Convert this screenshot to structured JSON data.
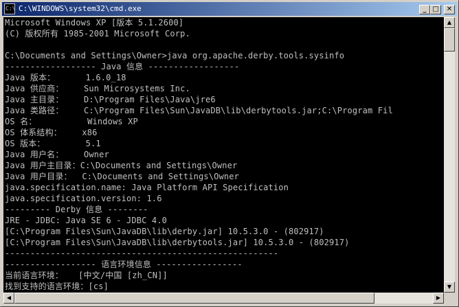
{
  "window": {
    "title": "C:\\WINDOWS\\system32\\cmd.exe",
    "icon_text": "C:\\"
  },
  "title_buttons": {
    "minimize": "_",
    "maximize": "□",
    "close": "✕"
  },
  "console": {
    "lines": [
      "Microsoft Windows XP [版本 5.1.2600]",
      "(C) 版权所有 1985-2001 Microsoft Corp.",
      "",
      "C:\\Documents and Settings\\Owner>java org.apache.derby.tools.sysinfo",
      "------------------ Java 信息 ------------------",
      "Java 版本：      1.6.0_18",
      "Java 供应商：    Sun Microsystems Inc.",
      "Java 主目录：    D:\\Program Files\\Java\\jre6",
      "Java 类路径：    C:\\Program Files\\Sun\\JavaDB\\lib\\derbytools.jar;C:\\Program Fil",
      "OS 名：          Windows XP",
      "OS 体系结构：    x86",
      "OS 版本：        5.1",
      "Java 用户名：    Owner",
      "Java 用户主目录：C:\\Documents and Settings\\Owner",
      "Java 用户目录：  C:\\Documents and Settings\\Owner",
      "java.specification.name: Java Platform API Specification",
      "java.specification.version: 1.6",
      "--------- Derby 信息 --------",
      "JRE - JDBC: Java SE 6 - JDBC 4.0",
      "[C:\\Program Files\\Sun\\JavaDB\\lib\\derby.jar] 10.5.3.0 - (802917)",
      "[C:\\Program Files\\Sun\\JavaDB\\lib\\derbytools.jar] 10.5.3.0 - (802917)",
      "------------------------------------------------------",
      "------------------ 语言环境信息 -----------------",
      "当前语言环境：   [中文/中国 [zh_CN]]",
      "找到支持的语言环境：[cs]"
    ]
  },
  "colors": {
    "console_bg": "#000000",
    "console_text": "#c0c0c0",
    "title_gradient_start": "#0a246a",
    "title_gradient_end": "#a6caf0",
    "chrome": "#d4d0c8"
  }
}
